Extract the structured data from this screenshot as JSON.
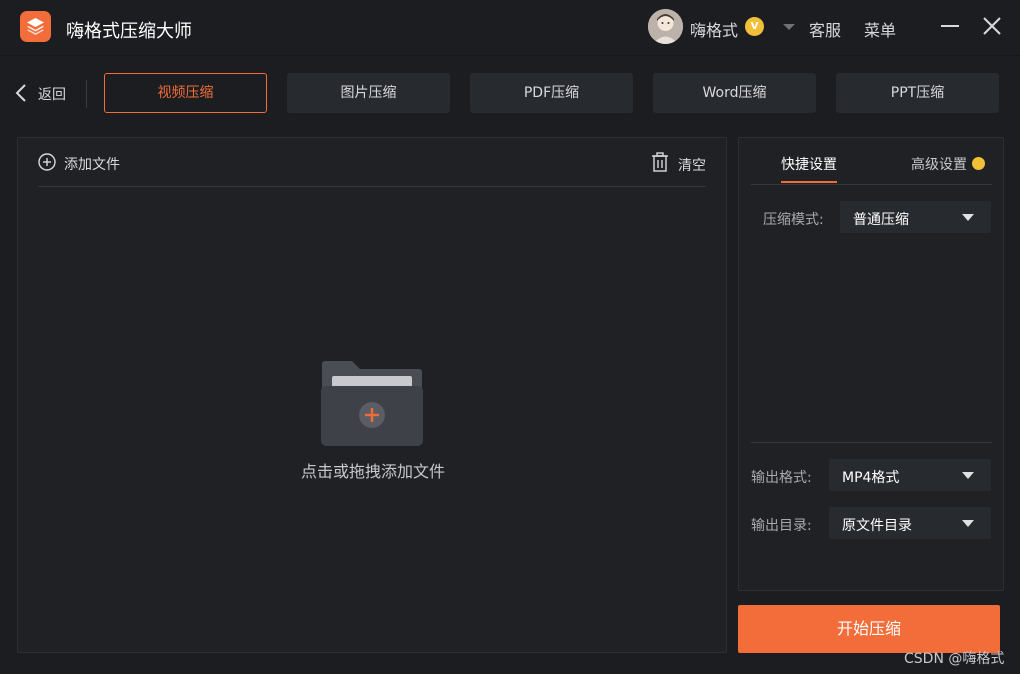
{
  "app": {
    "title": "嗨格式压缩大师",
    "logo_icon": "layers-icon",
    "accent_color": "#f26d3a"
  },
  "user": {
    "name": "嗨格式",
    "vip_badge": "V",
    "badge_color": "#f0c138"
  },
  "header": {
    "service_label": "客服",
    "menu_label": "菜单"
  },
  "nav": {
    "back_label": "返回",
    "tabs": [
      {
        "label": "视频压缩",
        "active": true
      },
      {
        "label": "图片压缩",
        "active": false
      },
      {
        "label": "PDF压缩",
        "active": false
      },
      {
        "label": "Word压缩",
        "active": false
      },
      {
        "label": "PPT压缩",
        "active": false
      }
    ]
  },
  "file_panel": {
    "add_file_label": "添加文件",
    "clear_label": "清空",
    "drop_hint": "点击或拖拽添加文件"
  },
  "settings": {
    "tabs": [
      {
        "label": "快捷设置",
        "active": true
      },
      {
        "label": "高级设置",
        "active": false
      }
    ],
    "compress_mode": {
      "label": "压缩模式:",
      "value": "普通压缩"
    },
    "output_format": {
      "label": "输出格式:",
      "value": "MP4格式"
    },
    "output_dir": {
      "label": "输出目录:",
      "value": "原文件目录"
    }
  },
  "start_button_label": "开始压缩",
  "watermark": "CSDN @嗨格式"
}
